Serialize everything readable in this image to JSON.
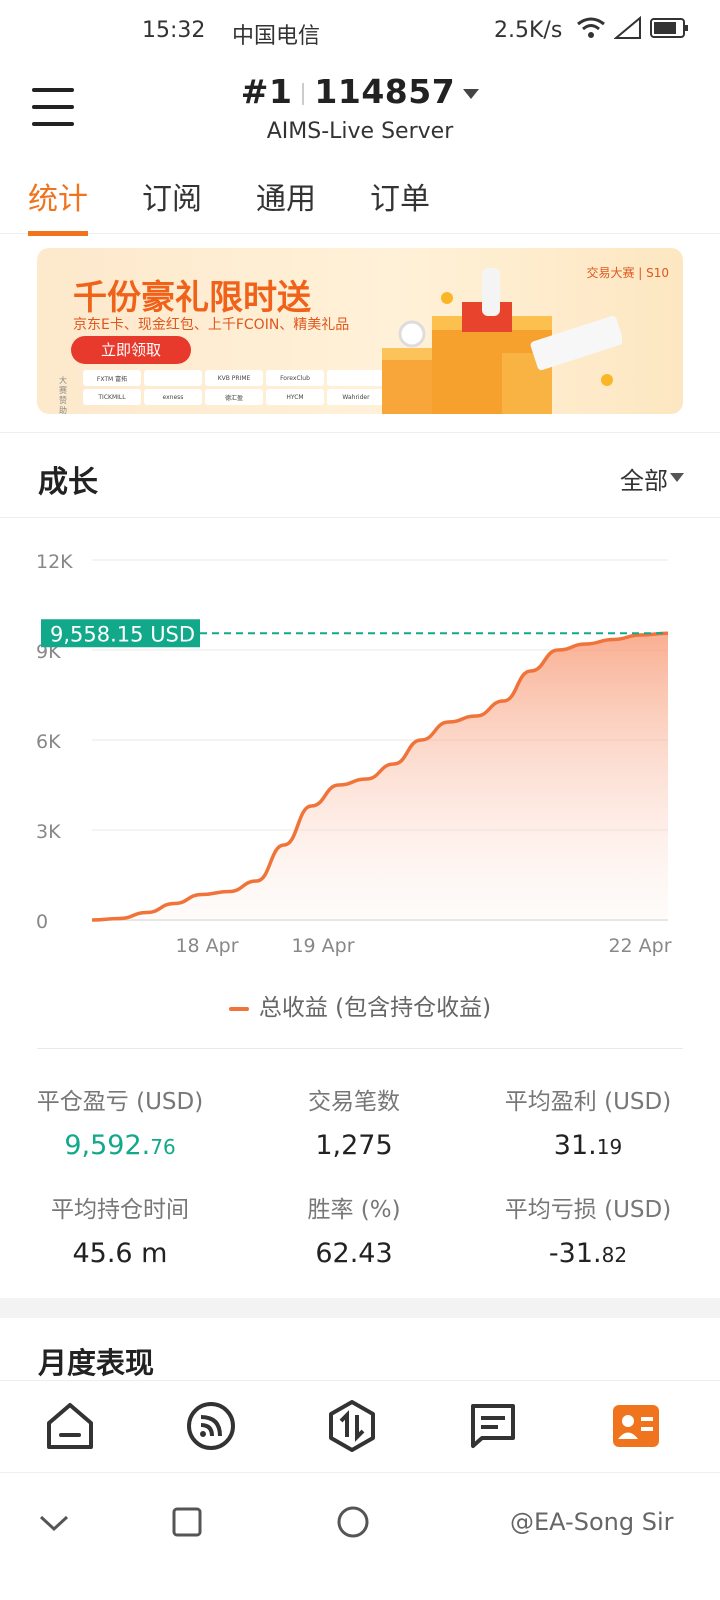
{
  "status_bar": {
    "time": "15:32",
    "carrier": "中国电信",
    "speed": "2.5K/s"
  },
  "header": {
    "account_prefix": "#1",
    "account_number": "114857",
    "server": "AIMS-Live Server"
  },
  "tabs": [
    {
      "label": "统计",
      "active": true
    },
    {
      "label": "订阅",
      "active": false
    },
    {
      "label": "通用",
      "active": false
    },
    {
      "label": "订单",
      "active": false
    }
  ],
  "banner": {
    "title": "千份豪礼限时送",
    "subtitle": "京东E卡、现金红包、上千FCOIN、精美礼品",
    "button": "立即领取",
    "sponsor_label": "大赛赞助",
    "brand": "交易大赛 | S10",
    "sponsors": [
      "FXTM 富拓",
      "",
      "KVB PRIME",
      "ForexClub",
      "",
      "TICKMILL",
      "exness",
      "德汇盈",
      "HYCM",
      "Wahrider"
    ]
  },
  "growth": {
    "title": "成长",
    "filter": "全部"
  },
  "chart_data": {
    "type": "area",
    "y_ticks": [
      "12K",
      "9K",
      "6K",
      "3K",
      "0"
    ],
    "x_ticks": [
      "18 Apr",
      "19 Apr",
      "22 Apr"
    ],
    "ylim": [
      0,
      12000
    ],
    "current_label": "9,558.15 USD",
    "current_value": 9558.15,
    "series": [
      {
        "name": "总收益 (包含持仓收益)",
        "color": "#f0733a",
        "values": [
          0,
          50,
          250,
          550,
          850,
          950,
          1300,
          2500,
          3800,
          4500,
          4700,
          5200,
          6000,
          6600,
          6800,
          7300,
          8300,
          9000,
          9200,
          9350,
          9500,
          9558
        ]
      }
    ]
  },
  "legend": {
    "label": "总收益 (包含持仓收益)"
  },
  "stats": [
    {
      "label": "平仓盈亏 (USD)",
      "value_main": "9,592.",
      "value_small": "76"
    },
    {
      "label": "交易笔数",
      "value_main": "1,275",
      "value_small": ""
    },
    {
      "label": "平均盈利 (USD)",
      "value_main": "31.",
      "value_small": "19"
    },
    {
      "label": "平均持仓时间",
      "value_main": "45.6 m",
      "value_small": ""
    },
    {
      "label": "胜率 (%)",
      "value_main": "62.43",
      "value_small": ""
    },
    {
      "label": "平均亏损 (USD)",
      "value_main": "-31.",
      "value_small": "82"
    }
  ],
  "monthly": {
    "title": "月度表现"
  },
  "bottom_nav": [
    "home-icon",
    "feed-icon",
    "trade-icon",
    "message-icon",
    "profile-card-icon"
  ],
  "watermark": "@EA-Song Sir",
  "colors": {
    "accent": "#f0741e",
    "positive": "#12a88a",
    "line": "#f0733a"
  }
}
